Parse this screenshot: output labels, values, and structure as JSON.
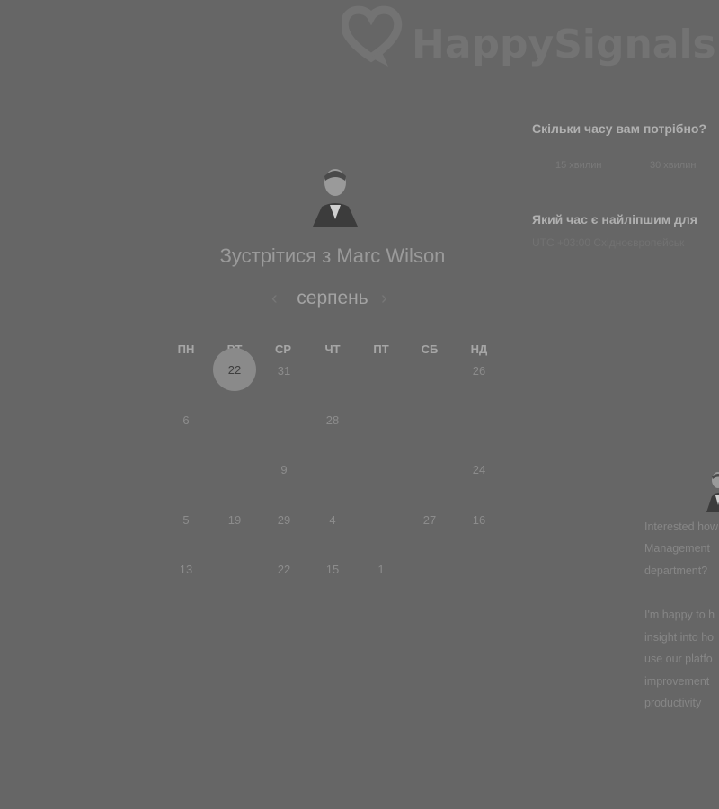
{
  "brand": {
    "logo_text": "HappySignals",
    "logo_color": "#737373"
  },
  "host": {
    "title": "Зустрітися з Marc Wilson"
  },
  "calendar": {
    "month": "серпень",
    "prev_icon": "chevron-left-icon",
    "next_icon": "chevron-right-icon",
    "weekdays": [
      "ПН",
      "ВТ",
      "СР",
      "ЧТ",
      "ПТ",
      "СБ",
      "НД"
    ],
    "selected_day": "22",
    "selected_color": "#8a8a8a",
    "weeks": [
      [
        "",
        "22",
        "31",
        "",
        "",
        "",
        "26"
      ],
      [
        "6",
        "",
        "",
        "28",
        "",
        "",
        ""
      ],
      [
        "",
        "",
        "9",
        "",
        "",
        "",
        "24"
      ],
      [
        "5",
        "19",
        "29",
        "4",
        "",
        "27",
        "16"
      ],
      [
        "13",
        "",
        "22",
        "15",
        "1",
        "",
        ""
      ]
    ]
  },
  "scheduler": {
    "duration_question": "Скільки часу вам потрібно?",
    "durations": [
      "15 хвилин",
      "30 хвилин"
    ],
    "time_question": "Який час є найліпшим для",
    "timezone": "UTC +03:00 Східноєвропейськ",
    "slots": [
      "",
      "",
      "",
      ""
    ]
  },
  "description": {
    "lines": [
      "Interested how",
      "Management",
      "department?",
      "",
      "I'm happy to h",
      "insight into ho",
      "use our platfo",
      "improvement",
      "productivity"
    ]
  }
}
